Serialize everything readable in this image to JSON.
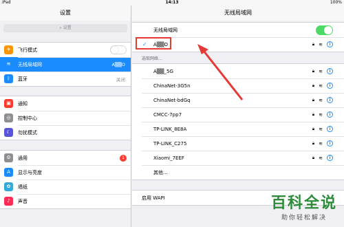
{
  "status": {
    "device": "iPad",
    "time": "14:13",
    "battery": "100%"
  },
  "left": {
    "title": "设置",
    "search_placeholder": "设置",
    "groups": [
      [
        {
          "label": "飞行模式",
          "icon": "airplane-icon",
          "color": "#ff9500",
          "glyph": "✈",
          "toggle": true
        },
        {
          "label": "无线局域网",
          "icon": "wifi-icon",
          "color": "#1a8cff",
          "glyph": "≋",
          "value": "A▒▒O",
          "selected": true
        },
        {
          "label": "蓝牙",
          "icon": "bluetooth-icon",
          "color": "#1a8cff",
          "glyph": "ᛒ",
          "value": "关闭"
        }
      ],
      [
        {
          "label": "通知",
          "icon": "notification-icon",
          "color": "#ff3b30",
          "glyph": "▣"
        },
        {
          "label": "控制中心",
          "icon": "control-center-icon",
          "color": "#8e8e93",
          "glyph": "◎"
        },
        {
          "label": "勿扰模式",
          "icon": "do-not-disturb-icon",
          "color": "#5856d6",
          "glyph": "☾"
        }
      ],
      [
        {
          "label": "通用",
          "icon": "general-icon",
          "color": "#8e8e93",
          "glyph": "⚙",
          "badge": "1"
        },
        {
          "label": "显示与亮度",
          "icon": "display-icon",
          "color": "#1a8cff",
          "glyph": "A"
        },
        {
          "label": "墙纸",
          "icon": "wallpaper-icon",
          "color": "#34aadc",
          "glyph": "✿"
        },
        {
          "label": "声音",
          "icon": "sound-icon",
          "color": "#ff2d55",
          "glyph": "♪"
        }
      ]
    ]
  },
  "right": {
    "title": "无线局域网",
    "wifi_label": "无线局域网",
    "wifi_on": true,
    "connected_network": "A▒▒O",
    "section_label": "选取网络...",
    "networks": [
      "A▒▒_5G",
      "ChinaNet-3G5n",
      "ChinaNet-bdGq",
      "CMCC-7pp7",
      "TP-LINK_8E8A",
      "TP-LINK_C275",
      "Xiaomi_7EEF"
    ],
    "other_label": "其他...",
    "wapi_label": "启用 WAPI"
  },
  "watermark": {
    "main": "百科全说",
    "sub": "助你轻松解决"
  }
}
